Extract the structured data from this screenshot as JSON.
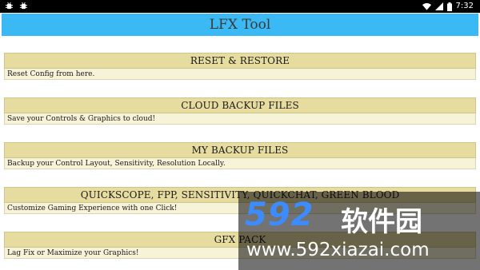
{
  "status_bar": {
    "time": "7:32",
    "left_icons": [
      "bug-icon",
      "bug-icon"
    ],
    "right_icons": [
      "wifi-icon",
      "signal-icon",
      "battery-icon"
    ]
  },
  "app_bar": {
    "title": "LFX Tool",
    "color": "#3ab9f5"
  },
  "colors": {
    "card_header": "#e6dca0",
    "card_desc": "#f7f3d8"
  },
  "options": [
    {
      "title": "RESET & RESTORE",
      "desc": "Reset Config from here."
    },
    {
      "title": "CLOUD BACKUP FILES",
      "desc": "Save your Controls & Graphics to cloud!"
    },
    {
      "title": "MY BACKUP FILES",
      "desc": "Backup your Control Layout, Sensitivity, Resolution Locally."
    },
    {
      "title": "QUICKSCOPE, FPP, SENSITIVITY, QUICKCHAT, GREEN BLOOD",
      "desc": "Customize Gaming Experience with one Click!"
    },
    {
      "title": "GFX PACK",
      "desc": "Lag Fix or Maximize your Graphics!"
    }
  ],
  "watermark": {
    "logo": "592",
    "cn_text": "软件园",
    "url": "www.592xiazai.com"
  }
}
